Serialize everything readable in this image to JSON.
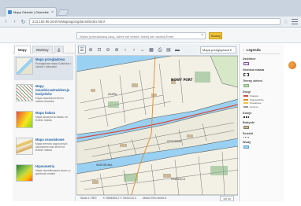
{
  "browser": {
    "tab_title": "Mapy Gdańsk | Gdańskie Informacje",
    "tab_close": "×",
    "back": "‹",
    "forward": "›",
    "reload": "↻",
    "url": "213.192.96.204/VivMap/apps/gdansk/index.html",
    "star": "☆"
  },
  "search": {
    "placeholder": "Wpisz poszukiwaną ulicę, adres lub obiekt i kliknij lub naciśnij Enter",
    "clear": "×",
    "button": "Szukaj"
  },
  "left_panel": {
    "tabs": [
      "Mapy",
      "Warstwy"
    ],
    "maps": [
      {
        "title": "Mapa przeglądowa",
        "desc": "Przeglądowa mapa Gdańska z ulicami i obiektami"
      },
      {
        "title": "Mapy zasadnicza/ewidencja budynków",
        "desc": "Mapa zasadnicza terenu miasta Gdańska"
      },
      {
        "title": "Mapa hałasu",
        "desc": "Mapa akustyczna hałasu na terenie miasta"
      },
      {
        "title": "Mapa osuwiskowe",
        "desc": "Mapa terenów zagrożonych osuwaniem mas ziemi na terenie miasta"
      },
      {
        "title": "Hipsometria",
        "desc": "Mapa ukształtowania terenu w granicach miasta"
      }
    ]
  },
  "toolbar": {
    "icons": [
      "☰",
      "⊕",
      "⊡",
      "⊖",
      "⊕",
      "‹",
      "›",
      "↔",
      "▦",
      "⎙",
      "▤",
      "▬"
    ],
    "basemap": "Mapa przeglądowa ▾"
  },
  "map": {
    "labels": [
      "NOWY PORT",
      "ZASPA",
      "STOCZNIA",
      "PRZEŁĘCZ",
      "WIDOKOWA"
    ]
  },
  "status": {
    "scale": "Skala 1:7500",
    "coords": "X: 6554654.2  Y: 5944123.3",
    "system": "Układ 2000 strefa 6",
    "btn": "Idź do"
  },
  "legend": {
    "title": "Legenda",
    "sections": [
      {
        "title": "Dzielnice"
      },
      {
        "title": "Granica miasta"
      },
      {
        "title": "Tereny zieleni"
      },
      {
        "title": "Drogi",
        "rows": [
          "Krajowe",
          "Wojewódzkie",
          "Powiatowe",
          "Gminne"
        ]
      },
      {
        "title": "Koleje"
      },
      {
        "title": "Budynki"
      },
      {
        "title": "Ścieżki"
      },
      {
        "title": "Wody"
      }
    ]
  },
  "colors": {
    "accent": "#2c69a8",
    "search_button": "#f1c232",
    "water": "#9ad1f3",
    "land": "#f3f1e6"
  }
}
